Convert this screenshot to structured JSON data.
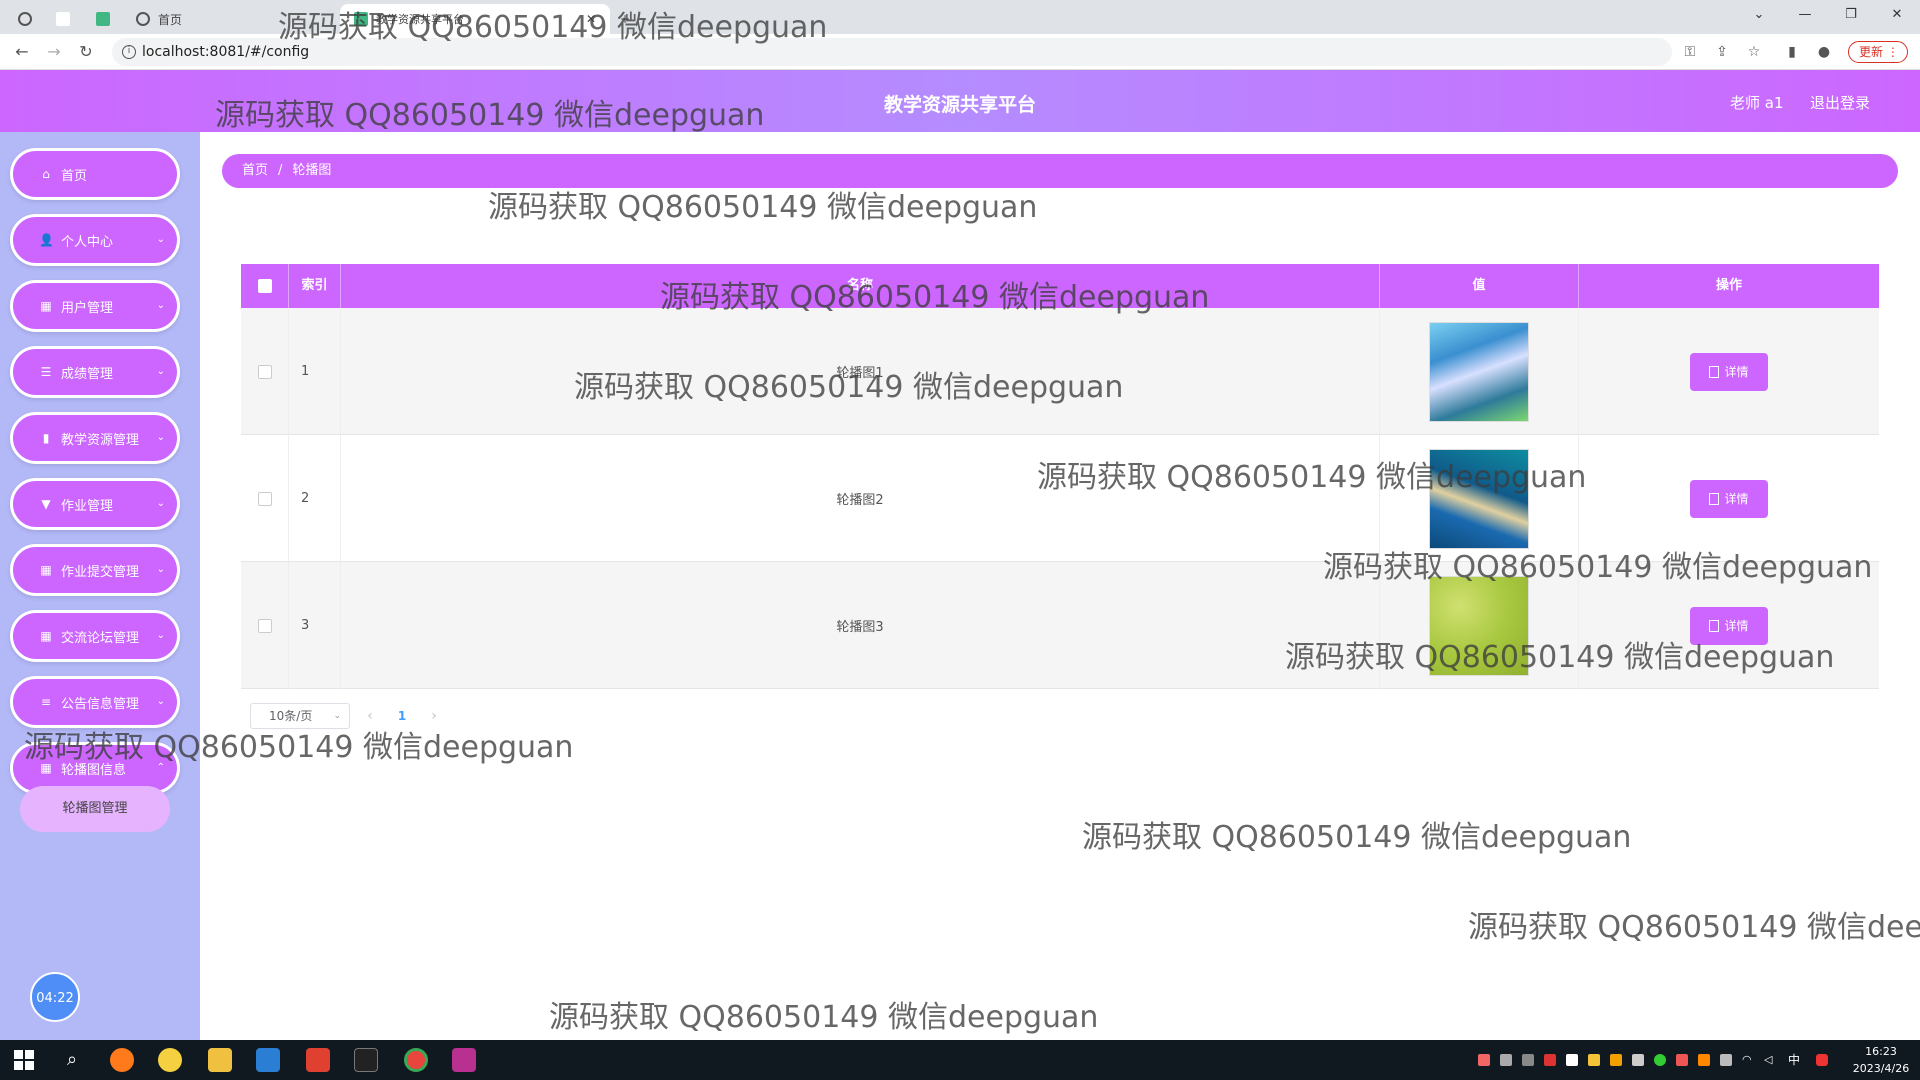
{
  "browser": {
    "tab_home_label": "首页",
    "active_tab_title": "教学资源共享平台",
    "url": "localhost:8081/#/config",
    "update_label": "更新"
  },
  "header": {
    "title": "教学资源共享平台",
    "user": "老师 a1",
    "logout": "退出登录"
  },
  "sidebar": {
    "items": [
      {
        "label": "首页",
        "icon": "home-icon"
      },
      {
        "label": "个人中心",
        "icon": "user-icon"
      },
      {
        "label": "用户管理",
        "icon": "grid-icon"
      },
      {
        "label": "成绩管理",
        "icon": "sliders-icon"
      },
      {
        "label": "教学资源管理",
        "icon": "chart-icon"
      },
      {
        "label": "作业管理",
        "icon": "brush-icon"
      },
      {
        "label": "作业提交管理",
        "icon": "grid-icon"
      },
      {
        "label": "交流论坛管理",
        "icon": "grid-icon"
      },
      {
        "label": "公告信息管理",
        "icon": "list-icon"
      },
      {
        "label": "轮播图信息",
        "icon": "grid-icon"
      }
    ],
    "submenu_label": "轮播图管理",
    "clock": "04:22"
  },
  "breadcrumb": {
    "home": "首页",
    "separator": "/",
    "current": "轮播图"
  },
  "table": {
    "columns": [
      "索引",
      "名称",
      "值",
      "操作"
    ],
    "rows": [
      {
        "index": "1",
        "name": "轮播图1",
        "action": "详情"
      },
      {
        "index": "2",
        "name": "轮播图2",
        "action": "详情"
      },
      {
        "index": "3",
        "name": "轮播图3",
        "action": "详情"
      }
    ]
  },
  "pagination": {
    "page_size": "10条/页",
    "current_page": "1"
  },
  "watermark": "源码获取 QQ86050149 微信deepguan",
  "taskbar": {
    "time": "16:23",
    "date": "2023/4/26",
    "ime": "中"
  },
  "colors": {
    "primary": "#cc66ff",
    "sidebar_bg": "#b3b8f7",
    "submenu_bg": "#e6b3ff"
  }
}
